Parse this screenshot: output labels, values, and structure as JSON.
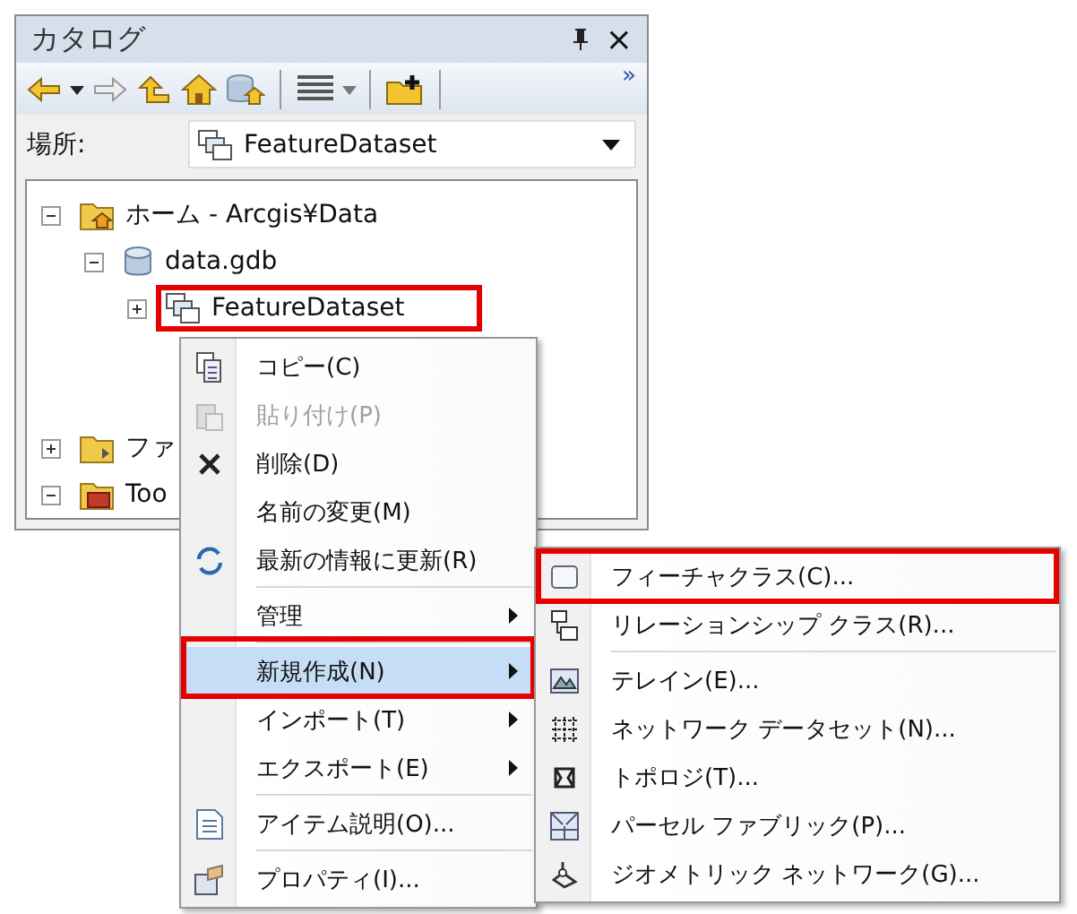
{
  "window": {
    "title": "カタログ",
    "close": "×",
    "overflow": "»"
  },
  "location": {
    "label": "場所:",
    "value": "FeatureDataset"
  },
  "tree": [
    {
      "label": "ホーム - Arcgis¥Data",
      "expanded": true,
      "highlighted": false,
      "children": [
        {
          "label": "data.gdb",
          "expanded": true,
          "highlighted": false,
          "children": [
            {
              "label": "FeatureDataset",
              "expanded": false,
              "highlighted": true
            }
          ]
        }
      ]
    },
    {
      "label": "ファ",
      "expanded": false,
      "highlighted": false,
      "gap": true
    },
    {
      "label": "Too",
      "expanded": true,
      "highlighted": false
    }
  ],
  "context_menu": [
    {
      "label": "コピー(C)",
      "disabled": false,
      "submenu": false,
      "selected": false,
      "highlighted": false,
      "separator_before": false
    },
    {
      "label": "貼り付け(P)",
      "disabled": true,
      "submenu": false,
      "selected": false,
      "highlighted": false,
      "separator_before": false
    },
    {
      "label": "削除(D)",
      "disabled": false,
      "submenu": false,
      "selected": false,
      "highlighted": false,
      "separator_before": false
    },
    {
      "label": "名前の変更(M)",
      "disabled": false,
      "submenu": false,
      "selected": false,
      "highlighted": false,
      "separator_before": false
    },
    {
      "label": "最新の情報に更新(R)",
      "disabled": false,
      "submenu": false,
      "selected": false,
      "highlighted": false,
      "separator_before": false
    },
    {
      "label": "管理",
      "disabled": false,
      "submenu": true,
      "selected": false,
      "highlighted": false,
      "separator_before": true
    },
    {
      "label": "新規作成(N)",
      "disabled": false,
      "submenu": true,
      "selected": true,
      "highlighted": true,
      "separator_before": true
    },
    {
      "label": "インポート(T)",
      "disabled": false,
      "submenu": true,
      "selected": false,
      "highlighted": false,
      "separator_before": false
    },
    {
      "label": "エクスポート(E)",
      "disabled": false,
      "submenu": true,
      "selected": false,
      "highlighted": false,
      "separator_before": false
    },
    {
      "label": "アイテム説明(O)...",
      "disabled": false,
      "submenu": false,
      "selected": false,
      "highlighted": false,
      "separator_before": true
    },
    {
      "label": "プロパティ(I)...",
      "disabled": false,
      "submenu": false,
      "selected": false,
      "highlighted": false,
      "separator_before": true
    }
  ],
  "submenu": [
    {
      "label": "フィーチャクラス(C)...",
      "highlighted": true,
      "separator_before": false
    },
    {
      "label": "リレーションシップ クラス(R)...",
      "highlighted": false,
      "separator_before": false
    },
    {
      "label": "テレイン(E)...",
      "highlighted": false,
      "separator_before": true
    },
    {
      "label": "ネットワーク データセット(N)...",
      "highlighted": false,
      "separator_before": false
    },
    {
      "label": "トポロジ(T)...",
      "highlighted": false,
      "separator_before": false
    },
    {
      "label": "パーセル ファブリック(P)...",
      "highlighted": false,
      "separator_before": false
    },
    {
      "label": "ジオメトリック ネットワーク(G)...",
      "highlighted": false,
      "separator_before": false
    }
  ]
}
